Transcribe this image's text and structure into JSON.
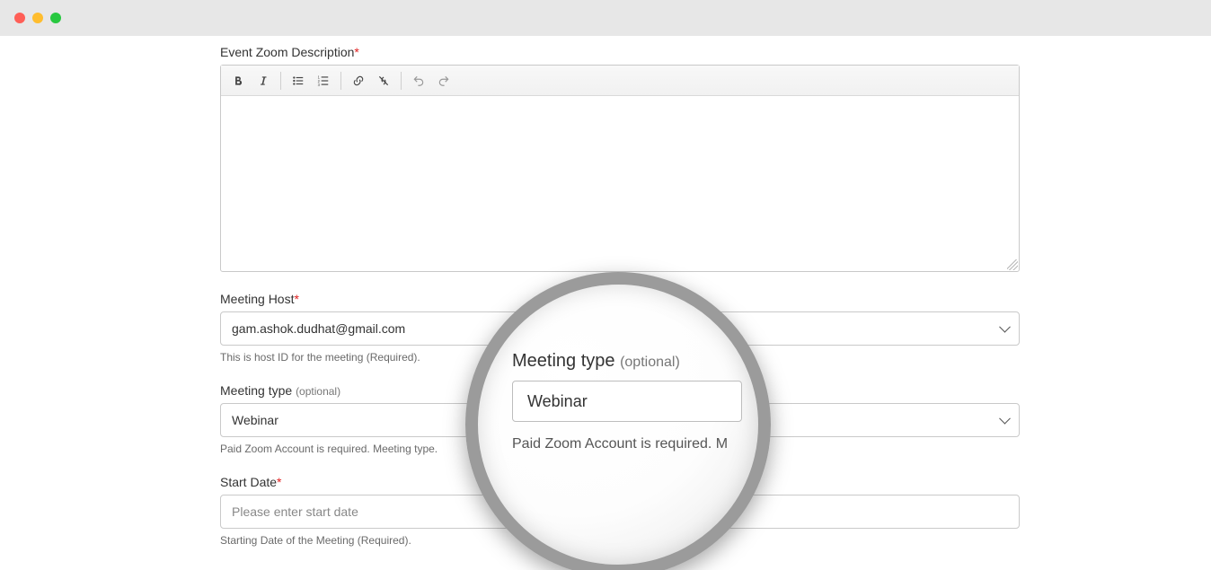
{
  "form": {
    "description": {
      "label": "Event Zoom Description",
      "required_mark": "*"
    },
    "host": {
      "label": "Meeting Host",
      "required_mark": "*",
      "value": "gam.ashok.dudhat@gmail.com",
      "help": "This is host ID for the meeting (Required)."
    },
    "meeting_type": {
      "label": "Meeting type",
      "optional_tag": "(optional)",
      "value": "Webinar",
      "help": "Paid Zoom Account is required. Meeting type."
    },
    "start_date": {
      "label": "Start Date",
      "required_mark": "*",
      "placeholder": "Please enter start date",
      "help": "Starting Date of the Meeting (Required)."
    }
  },
  "magnifier": {
    "label": "Meeting type",
    "optional_tag": "(optional)",
    "value": "Webinar",
    "help": "Paid Zoom Account is required. M"
  }
}
